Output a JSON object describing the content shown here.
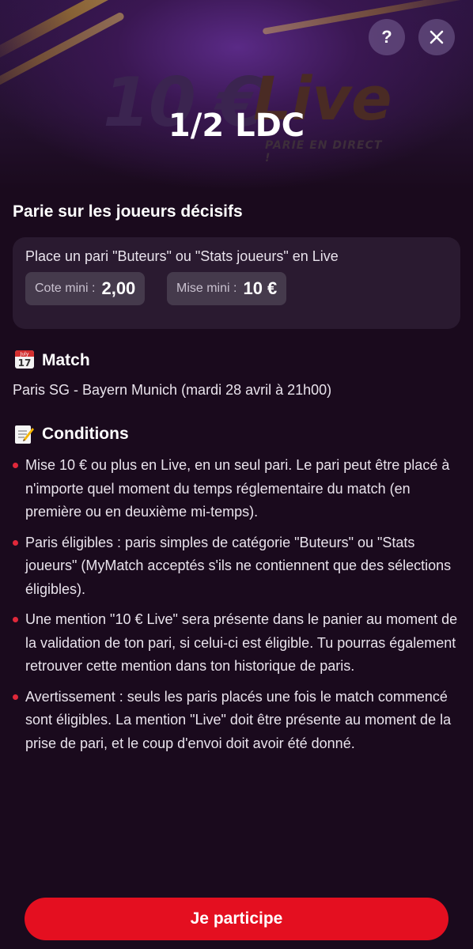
{
  "header": {
    "hero_text_big": "10 €",
    "hero_text_live": "Live",
    "hero_tagline": "PARIE EN DIRECT !",
    "title": "1/2 LDC",
    "help_label": "?",
    "help_icon": "question-icon",
    "close_icon": "close-icon"
  },
  "offer": {
    "heading": "Parie sur les joueurs décisifs",
    "description": "Place un pari \"Buteurs\" ou \"Stats joueurs\" en Live",
    "min_odds_label": "Cote mini :",
    "min_odds_value": "2,00",
    "min_stake_label": "Mise mini :",
    "min_stake_value": "10 €"
  },
  "match": {
    "icon": "calendar-icon",
    "calendar_month": "July",
    "calendar_day": "17",
    "heading": "Match",
    "details": "Paris SG - Bayern Munich (mardi 28 avril à 21h00)"
  },
  "conditions": {
    "icon": "memo-icon",
    "heading": "Conditions",
    "items": [
      "Mise 10 € ou plus en Live, en un seul pari. Le pari peut être placé à n'importe quel moment du temps réglementaire du match (en première ou en deuxième mi-temps).",
      "Paris éligibles : paris simples de catégorie \"Buteurs\" ou \"Stats joueurs\" (MyMatch acceptés s'ils ne contiennent que des sélections éligibles).",
      "Une mention \"10 € Live\" sera présente dans le panier au moment de la validation de ton pari, si celui-ci est éligible. Tu pourras également retrouver cette mention dans ton historique de paris.",
      "Avertissement : seuls les paris placés une fois le match commencé sont éligibles. La mention \"Live\" doit être présente au moment de la prise de pari, et le coup d'envoi doit avoir été donné."
    ]
  },
  "cta": {
    "label": "Je participe"
  },
  "colors": {
    "background": "#1a0a1d",
    "card": "#2a1a30",
    "chip": "#453a4c",
    "accent": "#e40f20",
    "bullet": "#e0283a"
  }
}
